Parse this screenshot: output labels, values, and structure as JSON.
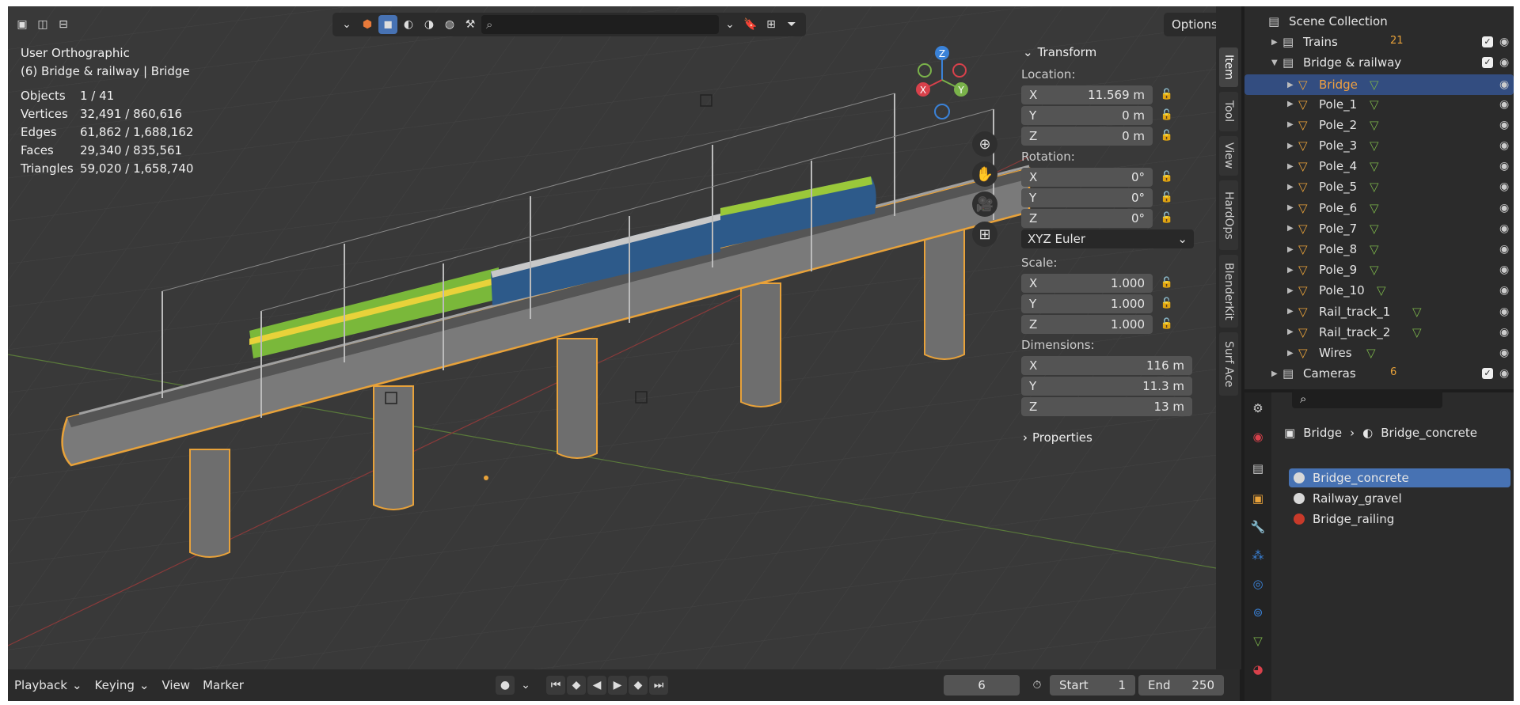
{
  "viewport": {
    "view_name": "User Orthographic",
    "context": "(6) Bridge & railway | Bridge",
    "stats": [
      {
        "k": "Objects",
        "v": "1 / 41"
      },
      {
        "k": "Vertices",
        "v": "32,491 / 860,616"
      },
      {
        "k": "Edges",
        "v": "61,862 / 1,688,162"
      },
      {
        "k": "Faces",
        "v": "29,340 / 835,561"
      },
      {
        "k": "Triangles",
        "v": "59,020 / 1,658,740"
      }
    ],
    "options_label": "Options",
    "search_placeholder": "",
    "gizmo": {
      "z": "Z",
      "x": "X",
      "y": "Y"
    }
  },
  "npanel": {
    "transform": "Transform",
    "location": "Location:",
    "rotation": "Rotation:",
    "scale": "Scale:",
    "dimensions": "Dimensions:",
    "properties": "Properties",
    "euler": "XYZ Euler",
    "loc": [
      {
        "a": "X",
        "v": "11.569 m"
      },
      {
        "a": "Y",
        "v": "0 m"
      },
      {
        "a": "Z",
        "v": "0 m"
      }
    ],
    "rot": [
      {
        "a": "X",
        "v": "0°"
      },
      {
        "a": "Y",
        "v": "0°"
      },
      {
        "a": "Z",
        "v": "0°"
      }
    ],
    "scl": [
      {
        "a": "X",
        "v": "1.000"
      },
      {
        "a": "Y",
        "v": "1.000"
      },
      {
        "a": "Z",
        "v": "1.000"
      }
    ],
    "dim": [
      {
        "a": "X",
        "v": "116 m"
      },
      {
        "a": "Y",
        "v": "11.3 m"
      },
      {
        "a": "Z",
        "v": "13 m"
      }
    ]
  },
  "tabs": [
    "Item",
    "Tool",
    "View",
    "HardOps",
    "BlenderKit",
    "Surf Ace"
  ],
  "outliner": {
    "root": "Scene Collection",
    "rows": [
      {
        "name": "Trains",
        "type": "collection",
        "depth": 1,
        "badge": "21"
      },
      {
        "name": "Bridge & railway",
        "type": "collection",
        "depth": 1,
        "open": true
      },
      {
        "name": "Bridge",
        "type": "mesh",
        "depth": 2,
        "selected": true
      },
      {
        "name": "Pole_1",
        "type": "mesh",
        "depth": 2
      },
      {
        "name": "Pole_2",
        "type": "mesh",
        "depth": 2
      },
      {
        "name": "Pole_3",
        "type": "mesh",
        "depth": 2
      },
      {
        "name": "Pole_4",
        "type": "mesh",
        "depth": 2
      },
      {
        "name": "Pole_5",
        "type": "mesh",
        "depth": 2
      },
      {
        "name": "Pole_6",
        "type": "mesh",
        "depth": 2
      },
      {
        "name": "Pole_7",
        "type": "mesh",
        "depth": 2
      },
      {
        "name": "Pole_8",
        "type": "mesh",
        "depth": 2
      },
      {
        "name": "Pole_9",
        "type": "mesh",
        "depth": 2
      },
      {
        "name": "Pole_10",
        "type": "mesh",
        "depth": 2
      },
      {
        "name": "Rail_track_1",
        "type": "mesh",
        "depth": 2
      },
      {
        "name": "Rail_track_2",
        "type": "mesh",
        "depth": 2
      },
      {
        "name": "Wires",
        "type": "mesh",
        "depth": 2
      },
      {
        "name": "Cameras",
        "type": "collection",
        "depth": 1,
        "badge": "6"
      }
    ]
  },
  "properties": {
    "breadcrumb_obj": "Bridge",
    "breadcrumb_mat": "Bridge_concrete",
    "materials": [
      {
        "name": "Bridge_concrete",
        "color": "#d8d8d8",
        "active": true
      },
      {
        "name": "Railway_gravel",
        "color": "#d8d8d8"
      },
      {
        "name": "Bridge_railing",
        "color": "#c83a2a"
      }
    ]
  },
  "timeline": {
    "playback": "Playback",
    "keying": "Keying",
    "view": "View",
    "marker": "Marker",
    "frame": "6",
    "start_label": "Start",
    "start": "1",
    "end_label": "End",
    "end": "250"
  },
  "colors": {
    "accent": "#4772b3",
    "selection": "#e8a23a",
    "x_axis": "#d8414b",
    "y_axis": "#7ab24a",
    "z_axis": "#3a82d8"
  }
}
